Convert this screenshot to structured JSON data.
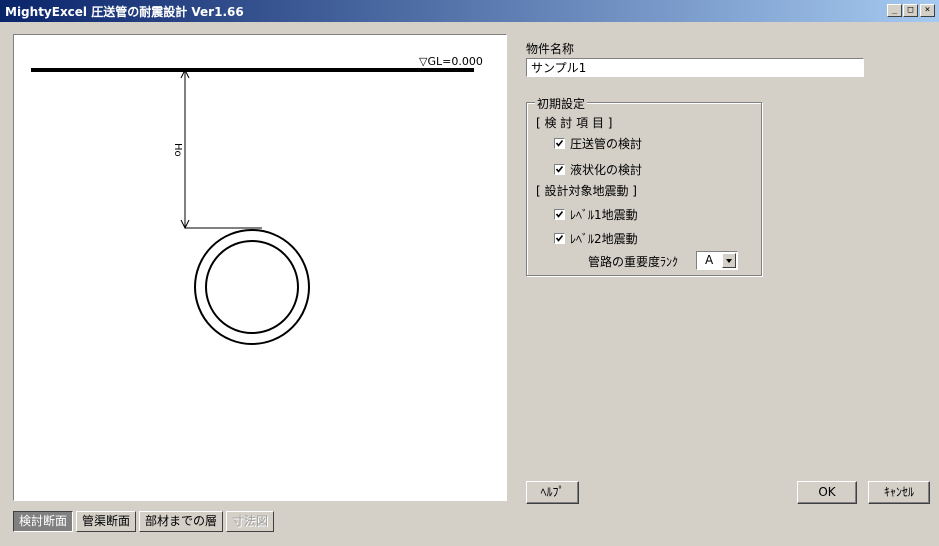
{
  "window": {
    "title": "MightyExcel 圧送管の耐震設計  Ver1.66",
    "controls": [
      "_",
      "□",
      "×"
    ]
  },
  "diagram": {
    "gl_label": "▽GL=0.000",
    "depth_label": "Ho"
  },
  "tabs": [
    {
      "label": "検討断面",
      "active": true,
      "enabled": true
    },
    {
      "label": "管渠断面",
      "active": false,
      "enabled": true
    },
    {
      "label": "部材までの層",
      "active": false,
      "enabled": true
    },
    {
      "label": "寸法図",
      "active": false,
      "enabled": false
    }
  ],
  "property": {
    "label": "物件名称",
    "value": "サンプル1"
  },
  "initial_settings": {
    "legend": "初期設定",
    "check_items_heading": "[ 検 討 項 目 ]",
    "check_items": [
      {
        "label": "圧送管の検討",
        "checked": true
      },
      {
        "label": "液状化の検討",
        "checked": true
      }
    ],
    "seismic_heading": "[ 設計対象地震動 ]",
    "seismic_items": [
      {
        "label": "ﾚﾍﾞﾙ1地震動",
        "checked": true
      },
      {
        "label": "ﾚﾍﾞﾙ2地震動",
        "checked": true
      }
    ],
    "rank_label": "管路の重要度ﾗﾝｸ",
    "rank_value": "A"
  },
  "buttons": {
    "help": "ﾍﾙﾌﾟ",
    "ok": "OK",
    "cancel": "ｷｬﾝｾﾙ"
  }
}
